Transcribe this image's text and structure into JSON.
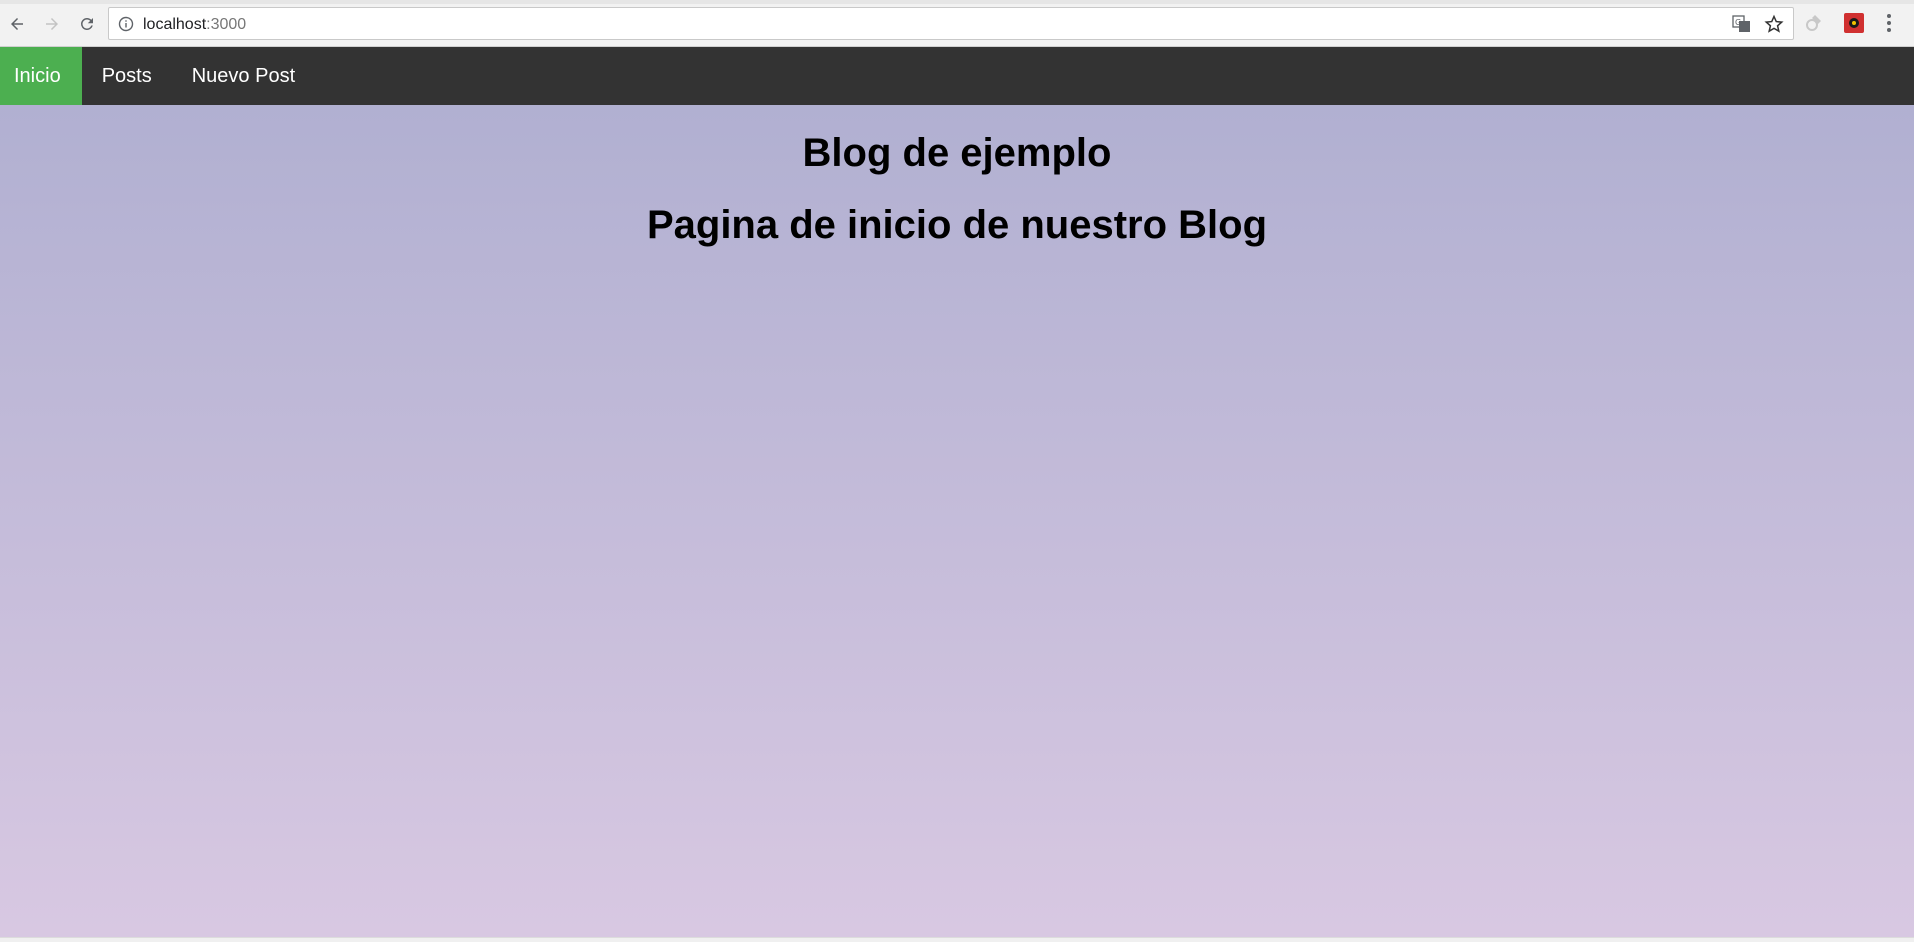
{
  "browser": {
    "url_host": "localhost",
    "url_port": ":3000",
    "icons": [
      "back-arrow-icon",
      "forward-arrow-icon",
      "reload-icon",
      "info-icon",
      "translate-icon",
      "star-icon",
      "extension-icon",
      "extension-icon",
      "menu-icon"
    ]
  },
  "navbar": {
    "items": [
      {
        "label": "Inicio",
        "active": true
      },
      {
        "label": "Posts",
        "active": false
      },
      {
        "label": "Nuevo Post",
        "active": false
      }
    ],
    "colors": {
      "background": "#333333",
      "active": "#4caf50",
      "text": "#ffffff"
    }
  },
  "main": {
    "title": "Blog de ejemplo",
    "subtitle": "Pagina de inicio de nuestro Blog"
  },
  "colors": {
    "gradient_top": "#aeaed0",
    "gradient_bottom": "#d8c8e2"
  }
}
